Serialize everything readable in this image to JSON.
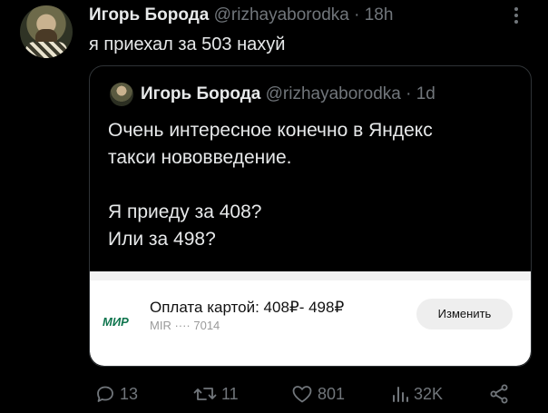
{
  "tweet": {
    "author_name": "Игорь Борода",
    "handle": "@rizhayaborodka",
    "separator": "·",
    "time": "18h",
    "more_icon": "more-dots-icon",
    "text": "я приехал за 503 нахуй"
  },
  "quoted": {
    "author_name": "Игорь Борода",
    "handle": "@rizhayaborodka",
    "separator": "·",
    "time": "1d",
    "lines": [
      "Очень интересное конечно в Яндекс",
      "такси нововведение.",
      "Я приеду за 408?",
      "Или за 498?"
    ],
    "payment_card": {
      "logo": "МИР",
      "title": "Оплата картой: 408₽- 498₽",
      "subtitle": "MIR ···· 7014",
      "button": "Изменить"
    }
  },
  "actions": {
    "replies": "13",
    "reposts": "11",
    "likes": "801",
    "views": "32K"
  },
  "colors": {
    "background": "#000000",
    "text": "#e7e9ea",
    "muted": "#71767b",
    "border": "#2f3336",
    "mir_green": "#0f754e"
  }
}
